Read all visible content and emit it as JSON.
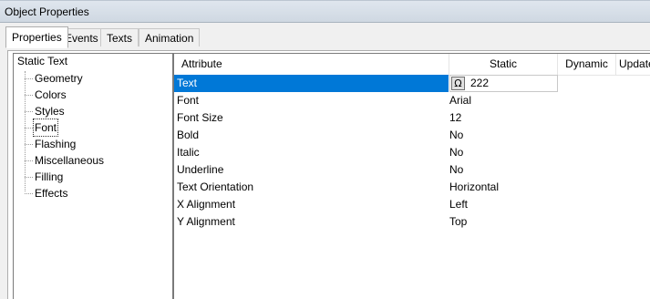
{
  "window": {
    "title": "Object Properties"
  },
  "tabs": [
    {
      "label": "Properties"
    },
    {
      "label": "Events"
    },
    {
      "label": "Texts"
    },
    {
      "label": "Animation"
    }
  ],
  "tree": {
    "root": "Static Text",
    "items": [
      {
        "label": "Geometry"
      },
      {
        "label": "Colors"
      },
      {
        "label": "Styles"
      },
      {
        "label": "Font"
      },
      {
        "label": "Flashing"
      },
      {
        "label": "Miscellaneous"
      },
      {
        "label": "Filling"
      },
      {
        "label": "Effects"
      }
    ]
  },
  "grid": {
    "columns": [
      "Attribute",
      "Static",
      "Dynamic",
      "Update"
    ],
    "rows": [
      {
        "attribute": "Text",
        "static": "222"
      },
      {
        "attribute": "Font",
        "static": "Arial"
      },
      {
        "attribute": "Font Size",
        "static": "12"
      },
      {
        "attribute": "Bold",
        "static": "No"
      },
      {
        "attribute": "Italic",
        "static": "No"
      },
      {
        "attribute": "Underline",
        "static": "No"
      },
      {
        "attribute": "Text Orientation",
        "static": "Horizontal"
      },
      {
        "attribute": "X Alignment",
        "static": "Left"
      },
      {
        "attribute": "Y Alignment",
        "static": "Top"
      }
    ],
    "editor_button_glyph": "Ω"
  },
  "colors": {
    "selection": "#0078d7"
  }
}
